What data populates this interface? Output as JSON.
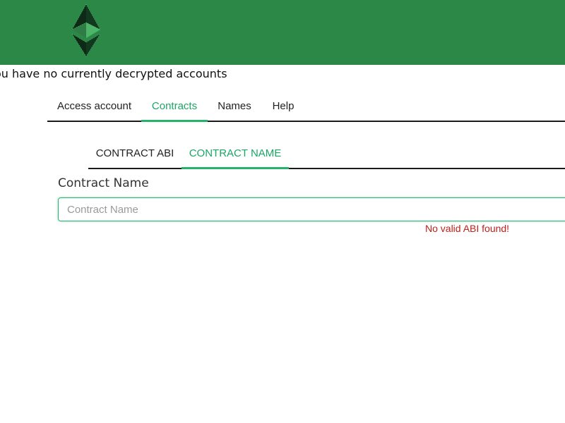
{
  "header": {
    "brand_color": "#2c8847",
    "logo_icon": "ethereum-classic-logo-icon"
  },
  "status": {
    "no_accounts_text": "ou have no currently decrypted accounts"
  },
  "main_tabs": [
    {
      "label": "Access account",
      "active": false
    },
    {
      "label": "Contracts",
      "active": true
    },
    {
      "label": "Names",
      "active": false
    },
    {
      "label": "Help",
      "active": false
    }
  ],
  "sub_tabs": [
    {
      "label": "CONTRACT ABI",
      "active": false
    },
    {
      "label": "CONTRACT NAME",
      "active": true
    }
  ],
  "form": {
    "label": "Contract Name",
    "input_value": "",
    "input_placeholder": "Contract Name",
    "error": "No valid ABI found!"
  },
  "colors": {
    "accent": "#1aa765",
    "error": "#c0201a"
  }
}
